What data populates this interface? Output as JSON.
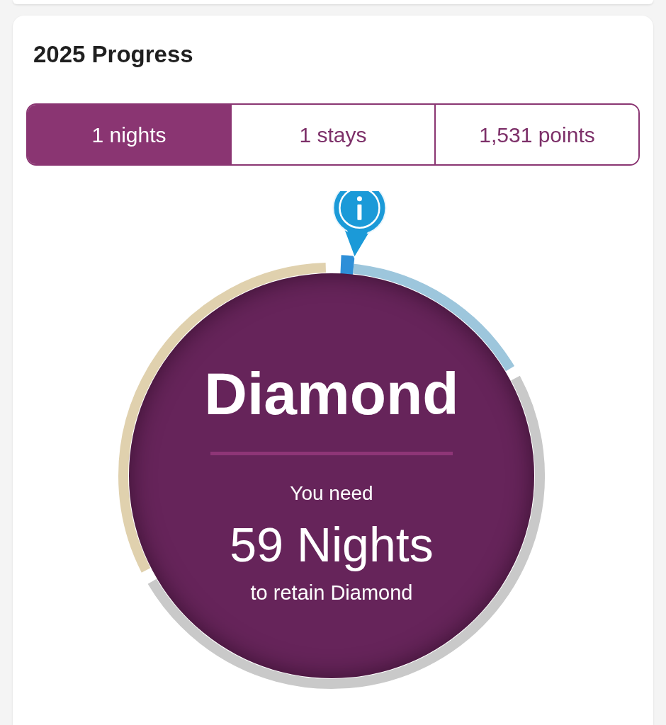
{
  "card": {
    "title": "2025 Progress"
  },
  "tabs": [
    {
      "label": "1 nights",
      "selected": true
    },
    {
      "label": "1 stays",
      "selected": false
    },
    {
      "label": "1,531 points",
      "selected": false
    }
  ],
  "progress": {
    "tier": "Diamond",
    "prompt": "You need",
    "amount": "59 Nights",
    "note": "to retain Diamond"
  }
}
